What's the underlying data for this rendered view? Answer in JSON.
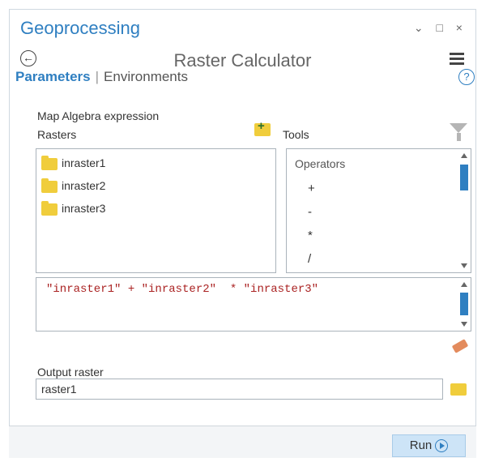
{
  "pane": {
    "title": "Geoprocessing",
    "controls": "⌄ □ ×"
  },
  "header": {
    "back_icon": "back-arrow-icon",
    "tool_title": "Raster Calculator",
    "menu_icon": "hamburger-menu-icon"
  },
  "tabs": [
    {
      "label": "Parameters",
      "active": true
    },
    {
      "label": "Environments",
      "active": false
    }
  ],
  "help": {
    "symbol": "?"
  },
  "expression_section": {
    "label": "Map Algebra expression",
    "rasters_label": "Rasters",
    "tools_label": "Tools",
    "rasters": [
      "inraster1",
      "inraster2",
      "inraster3"
    ],
    "tools_category": "Operators",
    "operators": [
      "+",
      "-",
      "*",
      "/"
    ],
    "expression": "\"inraster1\" + \"inraster2\"  * \"inraster3\""
  },
  "output": {
    "label": "Output raster",
    "value": "raster1"
  },
  "footer": {
    "run_label": "Run"
  },
  "colors": {
    "accent": "#2f7fc1",
    "folder": "#f0cd3c",
    "expression_text": "#aa2222",
    "run_button": "#cde4f7"
  }
}
